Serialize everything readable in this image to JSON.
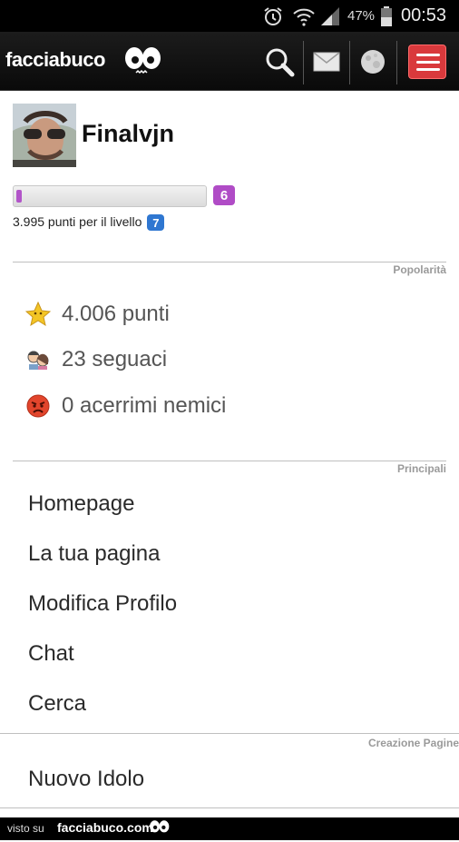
{
  "status_bar": {
    "battery": "47%",
    "time": "00:53",
    "icons": [
      "alarm-icon",
      "wifi-icon",
      "signal-icon",
      "battery-icon"
    ]
  },
  "app_bar": {
    "brand": "facciabuco",
    "icons": [
      "search-icon",
      "mail-icon",
      "moon-icon",
      "hamburger-menu-icon"
    ],
    "accent_color": "#d9393c"
  },
  "profile": {
    "username": "Finalvjn",
    "progress_fraction": 0.02,
    "current_level": "6",
    "points_to_next": "3.995 punti per il livello",
    "next_level": "7"
  },
  "sections": {
    "popularity_label": "Popolarità",
    "main_label": "Principali",
    "pages_label": "Creazione Pagine"
  },
  "stats": [
    {
      "icon": "star-icon",
      "text": "4.006 punti"
    },
    {
      "icon": "followers-icon",
      "text": "23 seguaci"
    },
    {
      "icon": "angry-face-icon",
      "text": "0 acerrimi nemici"
    }
  ],
  "menu": [
    "Homepage",
    "La tua pagina",
    "Modifica Profilo",
    "Chat",
    "Cerca"
  ],
  "pages_menu": [
    "Nuovo Idolo"
  ],
  "footer": {
    "prefix": "visto su",
    "site": "facciabuco.com"
  }
}
